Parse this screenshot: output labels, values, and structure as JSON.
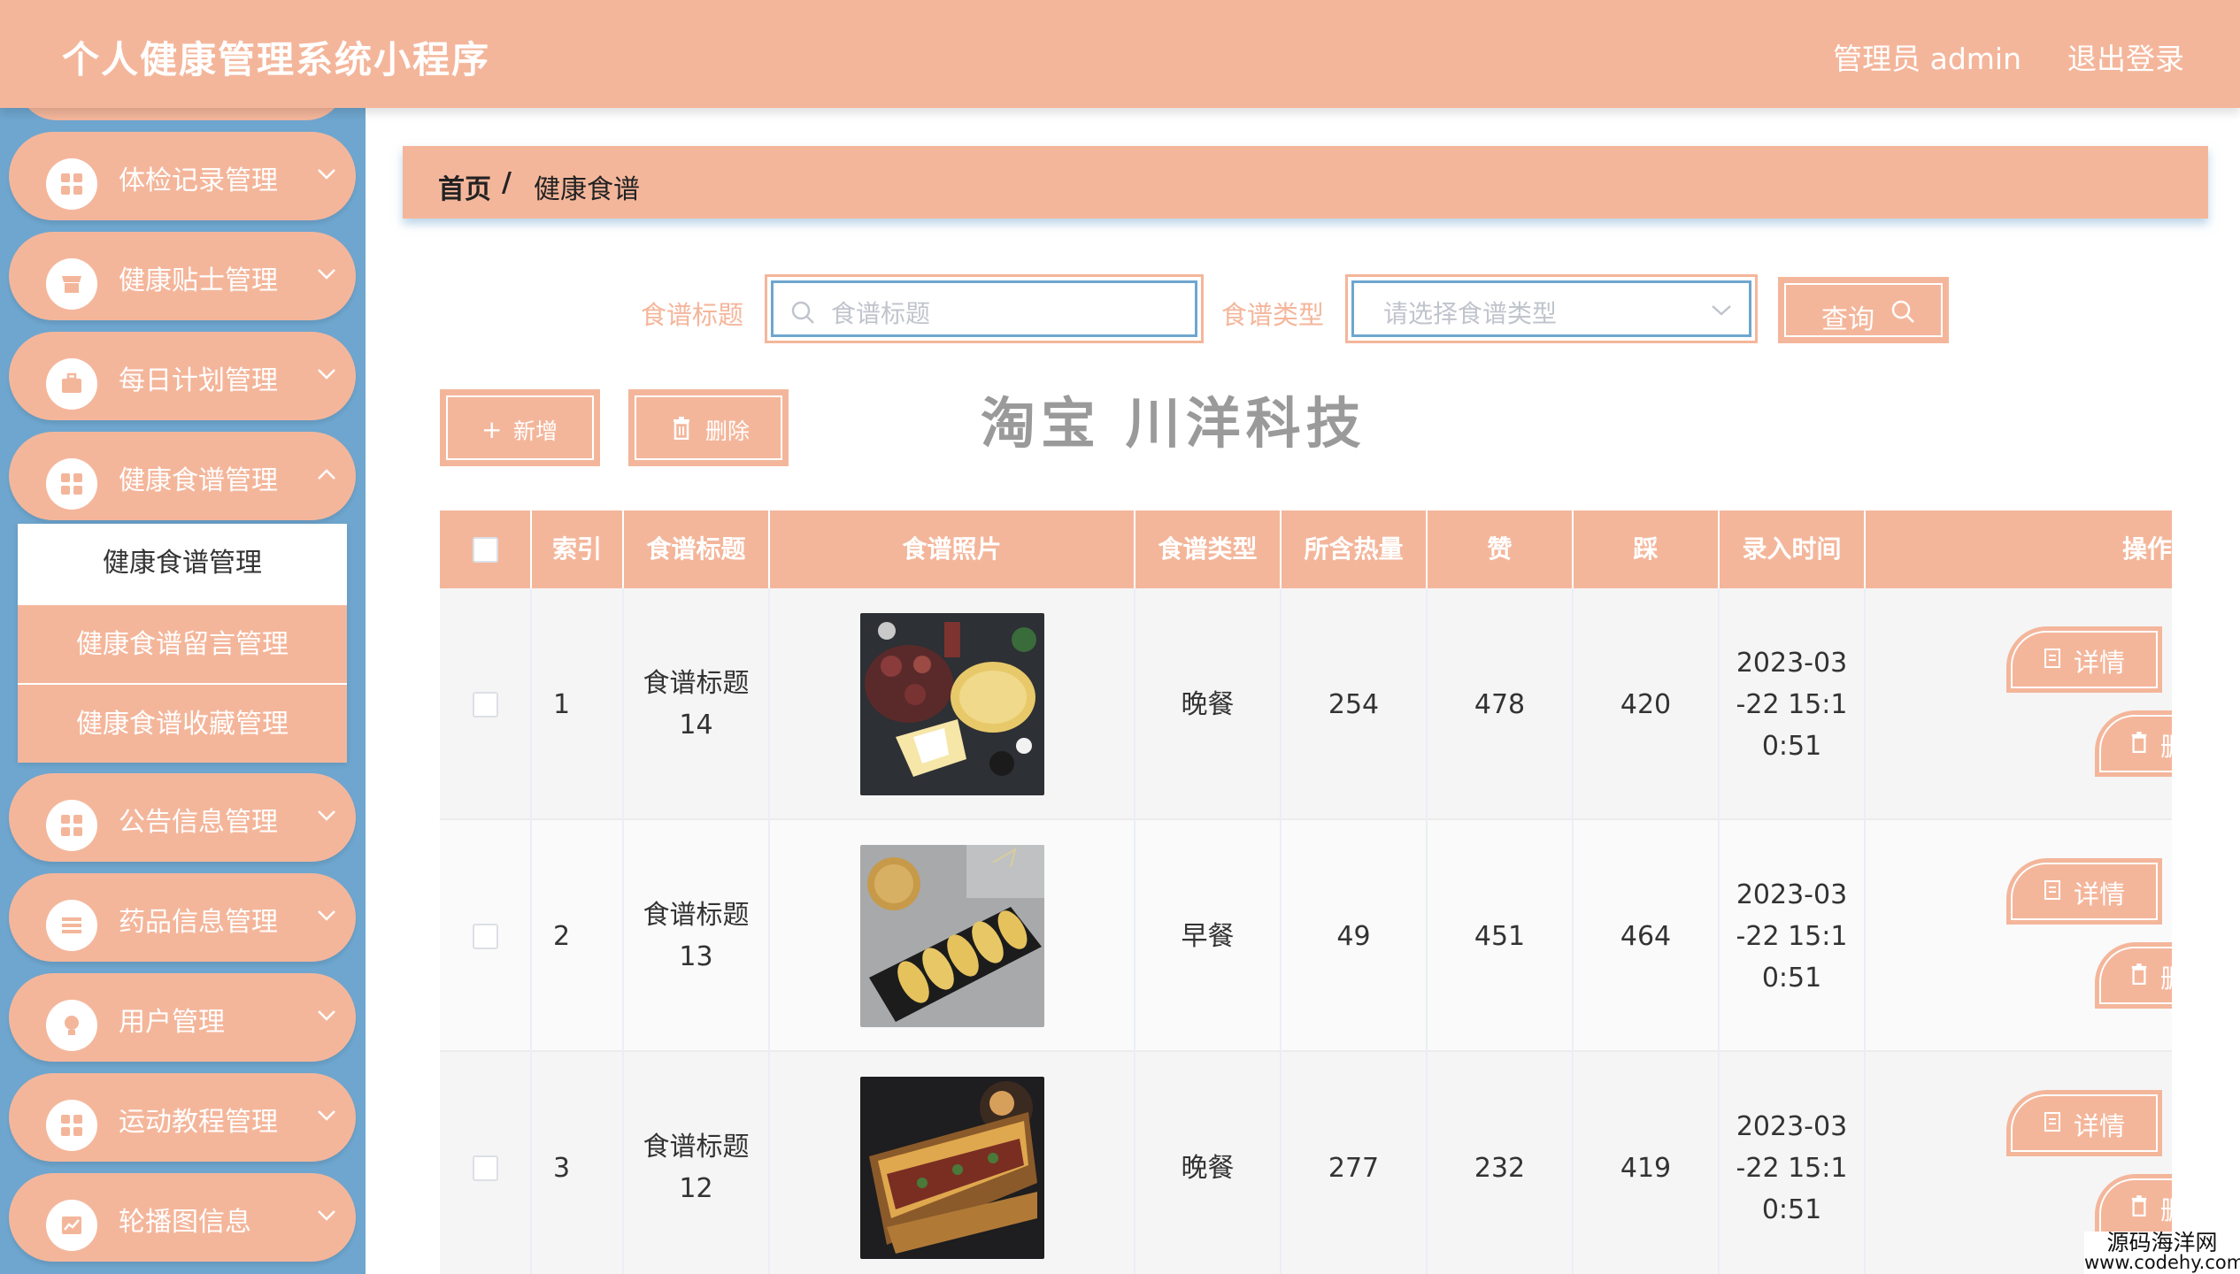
{
  "header": {
    "title": "个人健康管理系统小程序",
    "user": "管理员 admin",
    "logout": "退出登录"
  },
  "sidebar": {
    "items": [
      {
        "label": "体检记录管理",
        "icon": "grid-icon"
      },
      {
        "label": "健康贴士管理",
        "icon": "store-icon"
      },
      {
        "label": "每日计划管理",
        "icon": "briefcase-icon"
      },
      {
        "label": "健康食谱管理",
        "icon": "grid-icon"
      },
      {
        "label": "公告信息管理",
        "icon": "grid-icon"
      },
      {
        "label": "药品信息管理",
        "icon": "list-icon"
      },
      {
        "label": "用户管理",
        "icon": "bulb-icon"
      },
      {
        "label": "运动教程管理",
        "icon": "grid-icon"
      },
      {
        "label": "轮播图信息",
        "icon": "chart-icon"
      }
    ],
    "submenu": [
      "健康食谱管理",
      "健康食谱留言管理",
      "健康食谱收藏管理"
    ]
  },
  "breadcrumb": {
    "home": "首页",
    "sep": "/",
    "current": "健康食谱"
  },
  "search": {
    "title_label": "食谱标题",
    "title_placeholder": "食谱标题",
    "type_label": "食谱类型",
    "type_placeholder": "请选择食谱类型",
    "query_label": "查询"
  },
  "actions": {
    "add": "新增",
    "delete": "删除"
  },
  "watermark": "淘宝 川洋科技",
  "table": {
    "headers": [
      "索引",
      "食谱标题",
      "食谱照片",
      "食谱类型",
      "所含热量",
      "赞",
      "踩",
      "录入时间",
      "操作"
    ],
    "rows": [
      {
        "index": "1",
        "title_a": "食谱标题",
        "title_b": "14",
        "type": "晚餐",
        "calories": "254",
        "likes": "478",
        "dislikes": "420",
        "time_a": "2023-03",
        "time_b": "-22 15:1",
        "time_c": "0:51"
      },
      {
        "index": "2",
        "title_a": "食谱标题",
        "title_b": "13",
        "type": "早餐",
        "calories": "49",
        "likes": "451",
        "dislikes": "464",
        "time_a": "2023-03",
        "time_b": "-22 15:1",
        "time_c": "0:51"
      },
      {
        "index": "3",
        "title_a": "食谱标题",
        "title_b": "12",
        "type": "晚餐",
        "calories": "277",
        "likes": "232",
        "dislikes": "419",
        "time_a": "2023-03",
        "time_b": "-22 15:1",
        "time_c": "0:51"
      }
    ],
    "detail_label": "详情",
    "delete_label": "删除"
  },
  "corner_watermark": {
    "line1": "源码海洋网",
    "line2": "www.codehy.com"
  },
  "colors": {
    "accent": "#f4b69b",
    "sidebar": "#6ea6cf"
  }
}
